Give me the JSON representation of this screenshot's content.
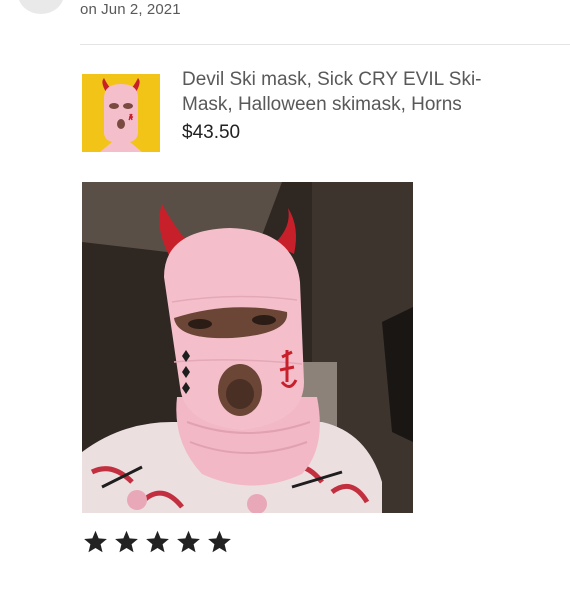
{
  "review": {
    "date_text": "on Jun 2, 2021",
    "rating": 5,
    "rating_max": 5
  },
  "listing": {
    "title": "Devil Ski mask, Sick CRY EVIL Ski-Mask, Halloween skimask, Horns",
    "price": "$43.50"
  },
  "icons": {
    "star": "star-filled-icon"
  },
  "colors": {
    "thumb_bg": "#f2c417",
    "mask_pink": "#f4bfcb",
    "horn_red": "#c8202a",
    "star": "#222222"
  }
}
